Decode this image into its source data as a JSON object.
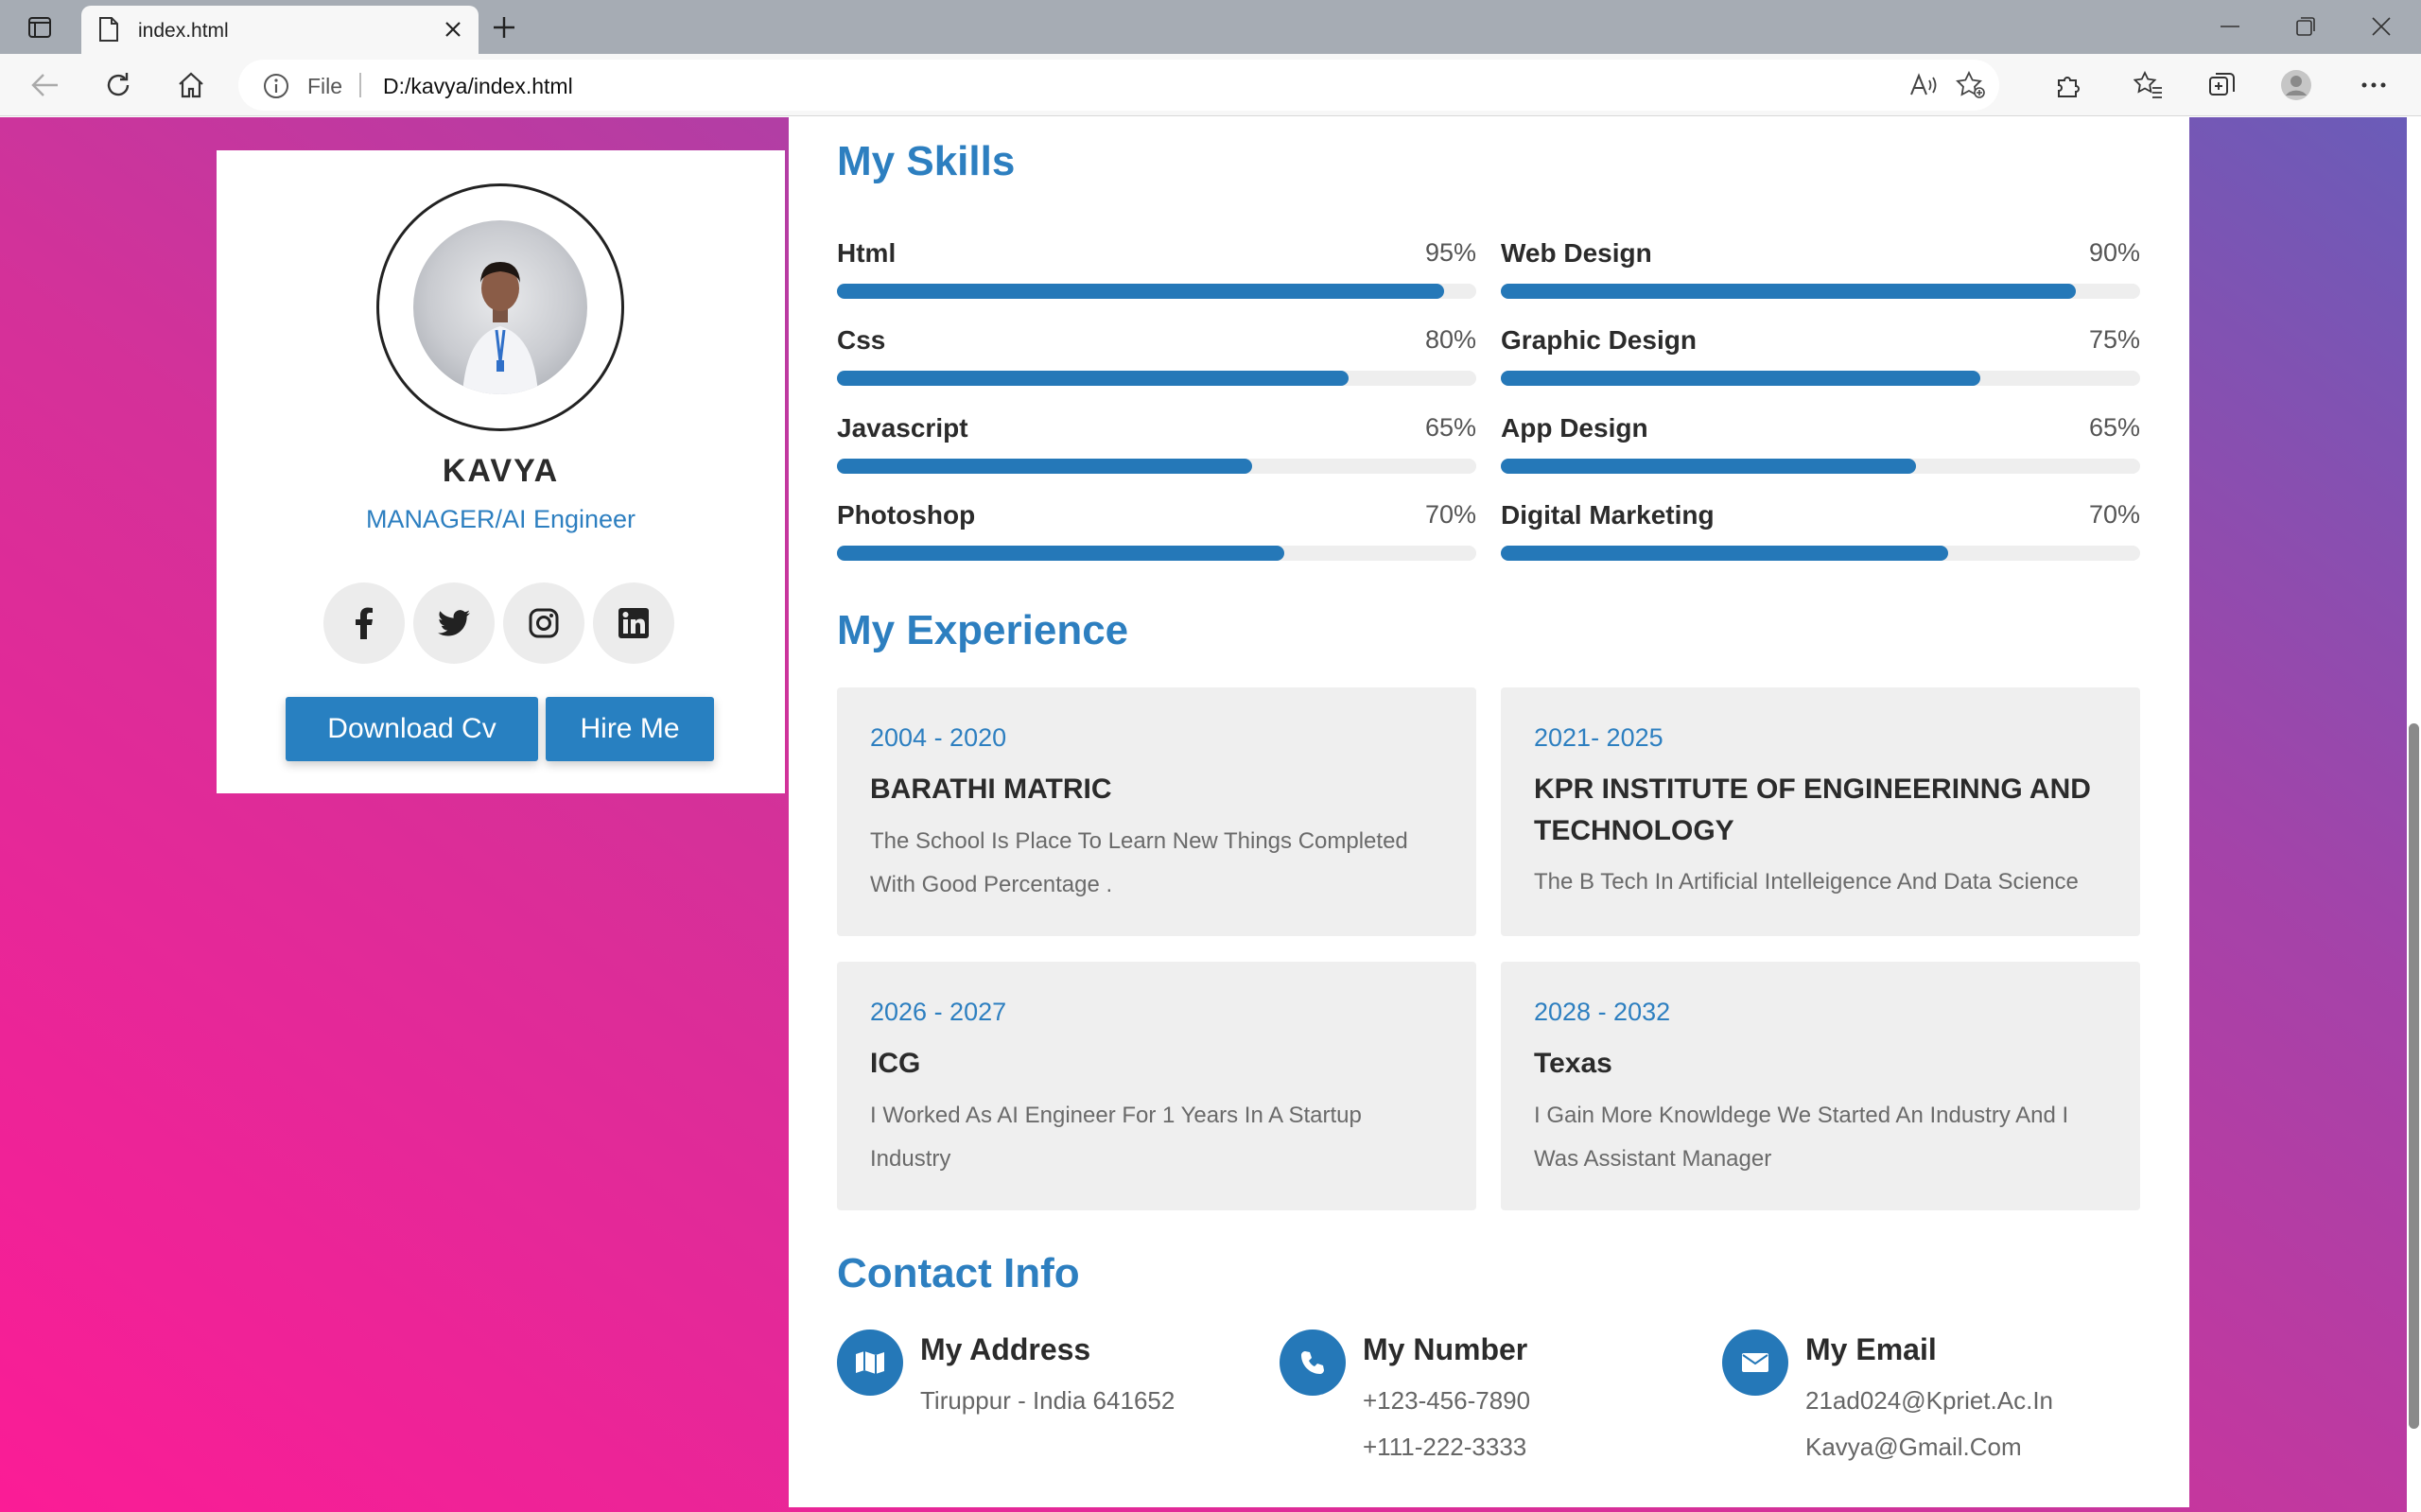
{
  "browser": {
    "tab_title": "index.html",
    "address_prefix": "File",
    "url": "D:/kavya/index.html"
  },
  "profile": {
    "name": "KAVYA",
    "role": "MANAGER/AI Engineer",
    "socials": [
      "facebook-icon",
      "twitter-icon",
      "instagram-icon",
      "linkedin-icon"
    ],
    "download_cv_label": "Download Cv",
    "hire_me_label": "Hire Me"
  },
  "skills": {
    "heading": "My Skills",
    "items": [
      {
        "label": "Html",
        "percent_text": "95%",
        "value": 95
      },
      {
        "label": "Web Design",
        "percent_text": "90%",
        "value": 90
      },
      {
        "label": "Css",
        "percent_text": "80%",
        "value": 80
      },
      {
        "label": "Graphic Design",
        "percent_text": "75%",
        "value": 75
      },
      {
        "label": "Javascript",
        "percent_text": "65%",
        "value": 65
      },
      {
        "label": "App Design",
        "percent_text": "65%",
        "value": 65
      },
      {
        "label": "Photoshop",
        "percent_text": "70%",
        "value": 70
      },
      {
        "label": "Digital Marketing",
        "percent_text": "70%",
        "value": 70
      }
    ]
  },
  "experience": {
    "heading": "My Experience",
    "items": [
      {
        "years": "2004 - 2020",
        "org": "BARATHI MATRIC",
        "desc": "The School Is Place To Learn New Things Completed With Good Percentage ."
      },
      {
        "years": "2021- 2025",
        "org": "KPR INSTITUTE OF ENGINEERINNG AND TECHNOLOGY",
        "desc": "The B Tech In Artificial Intelleigence And Data Science"
      },
      {
        "years": "2026 - 2027",
        "org": "ICG",
        "desc": "I Worked As AI Engineer For 1 Years In A Startup Industry"
      },
      {
        "years": "2028 - 2032",
        "org": "Texas",
        "desc": "I Gain More Knowldege We Started An Industry And I Was Assistant Manager"
      }
    ]
  },
  "contact": {
    "heading": "Contact Info",
    "items": [
      {
        "title": "My Address",
        "lines": [
          "Tiruppur - India 641652"
        ],
        "icon": "map-icon"
      },
      {
        "title": "My Number",
        "lines": [
          "+123-456-7890",
          "+111-222-3333"
        ],
        "icon": "phone-icon"
      },
      {
        "title": "My Email",
        "lines": [
          "21ad024@Kpriet.Ac.In",
          "Kavya@Gmail.Com"
        ],
        "icon": "envelope-icon"
      }
    ]
  },
  "colors": {
    "accent": "#2d7fc0",
    "bar_fill": "#2578b8",
    "bar_track": "#eeeeee",
    "gradient_start": "#fb1c96",
    "gradient_end": "#6a5cb8"
  }
}
